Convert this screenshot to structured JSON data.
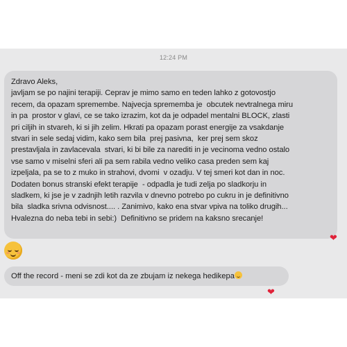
{
  "chat": {
    "timestamp": "12:24 PM",
    "messages": [
      {
        "lines": [
          "Zdravo Aleks,",
          "javljam se po najini terapiji. Ceprav je mimo samo en teden lahko z gotovostjo",
          "recem, da opazam spremembe. Najvecja sprememba je  obcutek nevtralnega miru",
          "in pa  prostor v glavi, ce se tako izrazim, kot da je odpadel mentalni BLOCK, zlasti",
          "pri ciljih in stvareh, ki si jih zelim. Hkrati pa opazam porast energije za vsakdanje",
          "stvari in sele sedaj vidim, kako sem bila  prej pasivna,  ker prej sem skoz",
          "prestavljala in zavlacevala  stvari, ki bi bile za narediti in je vecinoma vedno ostalo",
          "vse samo v miselni sferi ali pa sem rabila vedno veliko casa preden sem kaj",
          "izpeljala, pa se to z muko in strahovi, dvomi  v ozadju. V tej smeri kot dan in noc.",
          "Dodaten bonus stranski efekt terapije  - odpadla je tudi zelja po sladkorju in",
          "sladkem, ki jse je v zadnjih letih razvila v dnevno potrebo po cukru in je definitivno",
          "bila  sladka srivna odvisnost.... . Zanimivo, kako ena stvar vpiva na toliko drugih...",
          "Hvalezna do neba tebi in sebi:)  Definitivno se pridem na kaksno srecanje!"
        ],
        "reaction": "heart"
      },
      {
        "emoji": "smiling-face-with-hearts-emoji"
      },
      {
        "text": "Off the record - meni se zdi kot da ze zbujam iz nekega hedikepa",
        "trailing_emoji": "grimace-emoji",
        "reaction": "heart"
      }
    ]
  },
  "colors": {
    "screen_bg": "#e9e9ea",
    "bubble_bg": "#d6d6d8",
    "heart": "#e0233a"
  }
}
